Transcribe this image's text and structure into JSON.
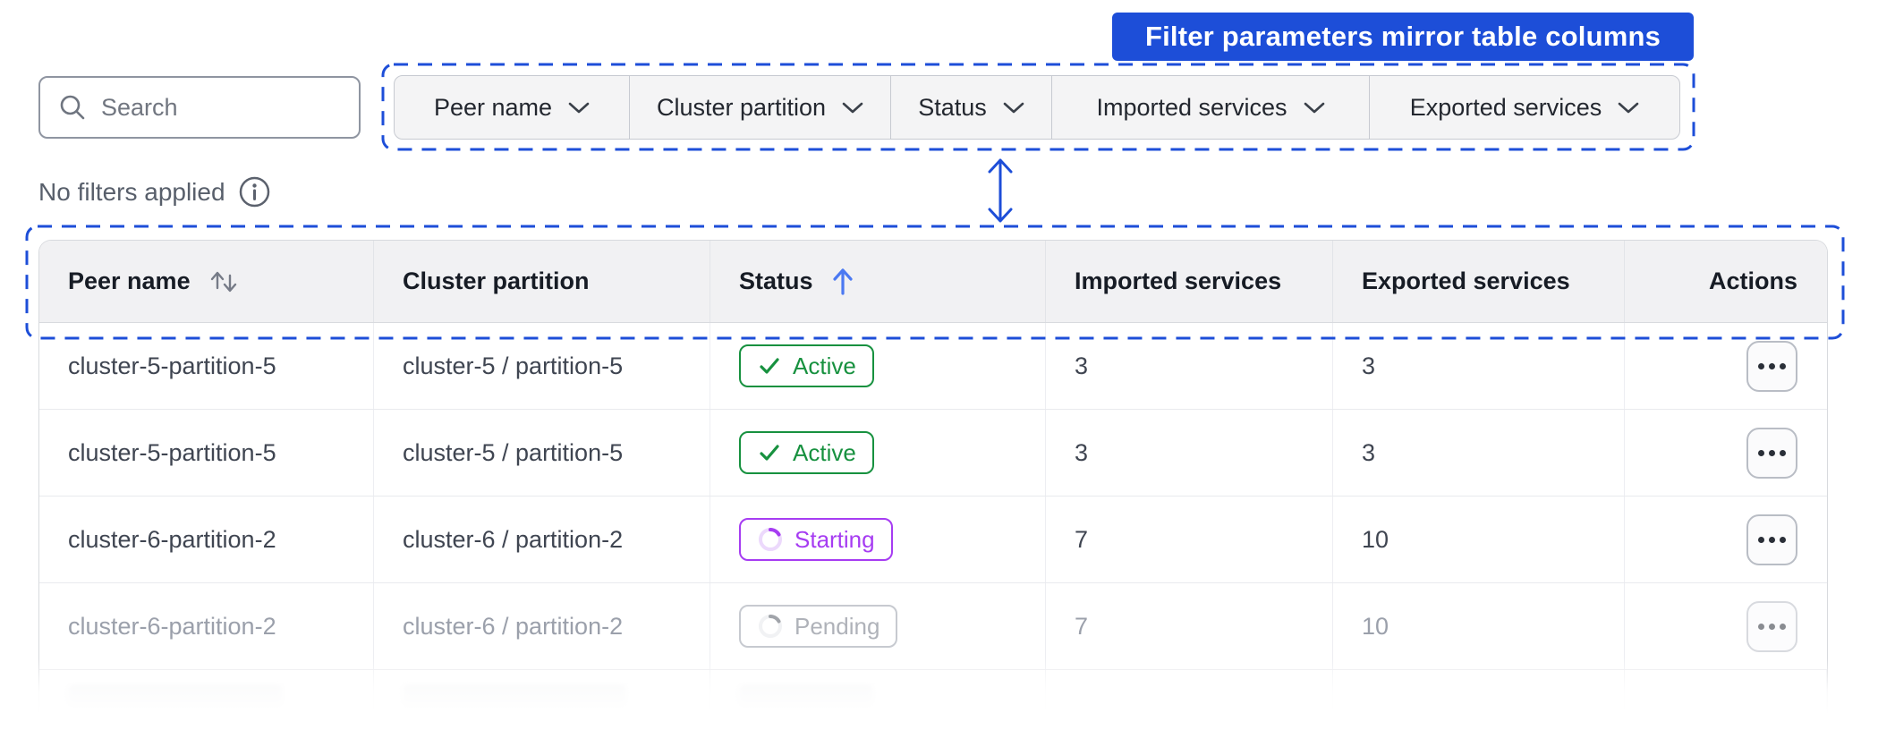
{
  "annotation": {
    "callout": "Filter parameters mirror table columns",
    "accent_color": "#1d4ed8"
  },
  "toolbar": {
    "search": {
      "placeholder": "Search"
    },
    "filters": [
      {
        "label": "Peer name"
      },
      {
        "label": "Cluster partition"
      },
      {
        "label": "Status"
      },
      {
        "label": "Imported services"
      },
      {
        "label": "Exported services"
      }
    ],
    "filters_status": "No filters applied"
  },
  "table": {
    "columns": [
      {
        "label": "Peer name",
        "sort": "sortable"
      },
      {
        "label": "Cluster partition",
        "sort": null
      },
      {
        "label": "Status",
        "sort": "asc"
      },
      {
        "label": "Imported services",
        "sort": null
      },
      {
        "label": "Exported services",
        "sort": null
      },
      {
        "label": "Actions",
        "sort": null
      }
    ],
    "rows": [
      {
        "peer_name": "cluster-5-partition-5",
        "cluster_partition": "cluster-5 / partition-5",
        "status": "Active",
        "status_kind": "active",
        "imported_services": "3",
        "exported_services": "3"
      },
      {
        "peer_name": "cluster-5-partition-5",
        "cluster_partition": "cluster-5 / partition-5",
        "status": "Active",
        "status_kind": "active",
        "imported_services": "3",
        "exported_services": "3"
      },
      {
        "peer_name": "cluster-6-partition-2",
        "cluster_partition": "cluster-6 / partition-2",
        "status": "Starting",
        "status_kind": "starting",
        "imported_services": "7",
        "exported_services": "10"
      },
      {
        "peer_name": "cluster-6-partition-2",
        "cluster_partition": "cluster-6 / partition-2",
        "status": "Pending",
        "status_kind": "pending",
        "imported_services": "7",
        "exported_services": "10"
      }
    ],
    "status_colors": {
      "active": "#17913f",
      "starting": "#a63cf2",
      "pending": "#6f7580"
    }
  }
}
